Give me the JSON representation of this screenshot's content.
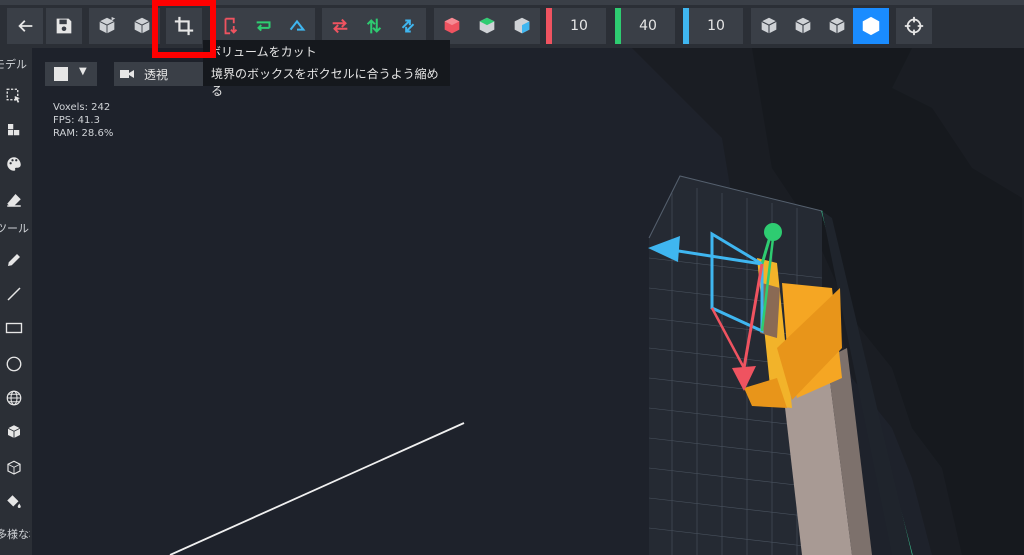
{
  "toolbar": {
    "axis_x_value": "10",
    "axis_y_value": "40",
    "axis_z_value": "10",
    "axis_colors": {
      "x": "#ef5360",
      "y": "#2ecc71",
      "z": "#3fb6f0"
    }
  },
  "tooltip": {
    "title": "ボリュームをカット",
    "description": "境界のボックスをボクセルに合うよう縮める"
  },
  "sidebar": {
    "section_mode_label": "モデル",
    "section_tools_label": "ツール",
    "section_bottom_label": "多様な構成"
  },
  "viewport": {
    "view_mode_label": "透視",
    "stats": {
      "voxels": "Voxels: 242",
      "fps": "FPS: 41.3",
      "ram": "RAM: 28.6%"
    }
  },
  "colors": {
    "accent": "#1a8cff",
    "highlight": "#ff0000"
  }
}
